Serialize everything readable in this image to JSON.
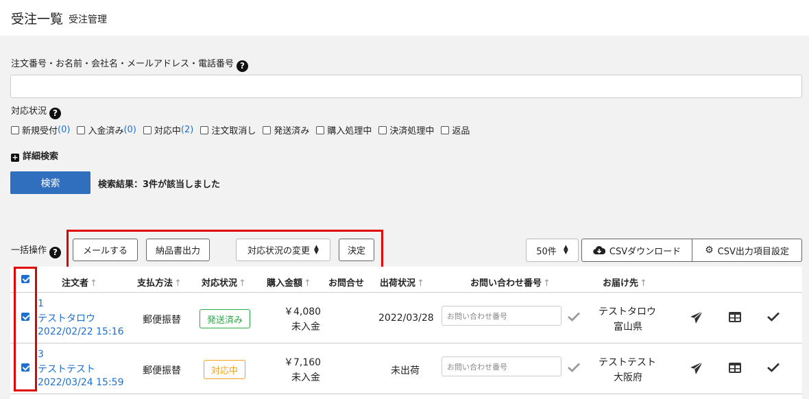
{
  "header": {
    "title": "受注一覧",
    "subtitle": "受注管理"
  },
  "search": {
    "label": "注文番号・お名前・会社名・メールアドレス・電話番号",
    "value": "",
    "button_label": "検索",
    "result_text": "検索結果：3件が該当しました"
  },
  "status_filter": {
    "label": "対応状況",
    "options": [
      {
        "label": "新規受付",
        "count": "(0)"
      },
      {
        "label": "入金済み",
        "count": "(0)"
      },
      {
        "label": "対応中",
        "count": "(2)"
      },
      {
        "label": "注文取消し",
        "count": ""
      },
      {
        "label": "発送済み",
        "count": ""
      },
      {
        "label": "購入処理中",
        "count": ""
      },
      {
        "label": "決済処理中",
        "count": ""
      },
      {
        "label": "返品",
        "count": ""
      }
    ]
  },
  "detail_search": {
    "label": "詳細検索"
  },
  "bulk": {
    "label": "一括操作",
    "mail_button": "メールする",
    "delivery_button": "納品書出力",
    "status_select": "対応状況の変更",
    "decide_button": "決定"
  },
  "list_tools": {
    "per_page": "50件",
    "csv_download": "CSVダウンロード",
    "csv_settings": "CSV出力項目設定"
  },
  "table": {
    "headers": {
      "orderer": "注文者",
      "payment": "支払方法",
      "status": "対応状況",
      "amount": "購入金額",
      "contact": "お問合せ",
      "shipping": "出荷状況",
      "inquiry_no": "お問い合わせ番号",
      "destination": "お届け先"
    },
    "sort_arrow": "↑",
    "rows": [
      {
        "id": "1",
        "name": "テストタロウ",
        "datetime": "2022/02/22 15:16",
        "payment": "郵便振替",
        "status": "発送済み",
        "amount": "￥4,080",
        "payment_status": "未入金",
        "shipping": "2022/03/28",
        "inquiry_placeholder": "お問い合わせ番号",
        "dest_name": "テストタロウ",
        "dest_pref": "富山県"
      },
      {
        "id": "3",
        "name": "テストテスト",
        "datetime": "2022/03/24 15:59",
        "payment": "郵便振替",
        "status": "対応中",
        "amount": "￥7,160",
        "payment_status": "未入金",
        "shipping": "未出荷",
        "inquiry_placeholder": "お問い合わせ番号",
        "dest_name": "テストテスト",
        "dest_pref": "大阪府"
      }
    ]
  },
  "icons": {
    "help": "question-circle-icon",
    "plus": "plus-square-icon",
    "cloud": "cloud-download-icon",
    "gear": "gear-icon",
    "send": "paper-plane-icon",
    "table": "table-icon",
    "check": "check-icon"
  },
  "colors": {
    "primary": "#2f6fbd",
    "link": "#1e6fd0",
    "badge_shipped": "#28a745",
    "badge_in_progress": "#f0a020",
    "highlight": "#e00000"
  }
}
